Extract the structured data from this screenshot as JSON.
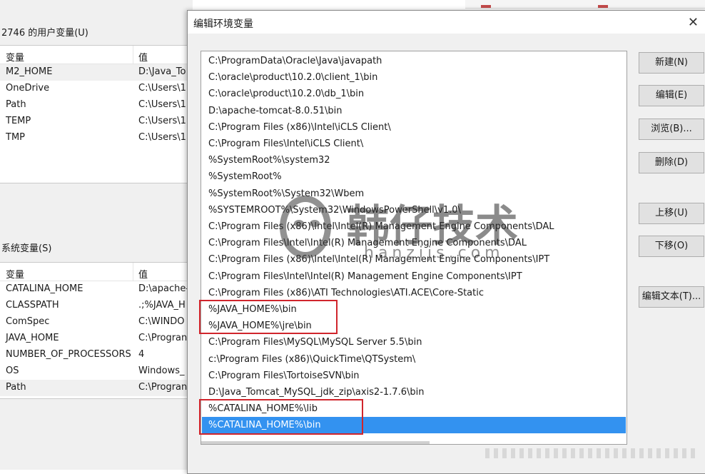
{
  "background_window": {
    "user_vars_label": "2746 的用户变量(U)",
    "user_vars": {
      "col_var": "变量",
      "col_val": "值",
      "rows": [
        {
          "name": "M2_HOME",
          "value": "D:\\Java_To"
        },
        {
          "name": "OneDrive",
          "value": "C:\\Users\\1"
        },
        {
          "name": "Path",
          "value": "C:\\Users\\1"
        },
        {
          "name": "TEMP",
          "value": "C:\\Users\\1"
        },
        {
          "name": "TMP",
          "value": "C:\\Users\\1"
        }
      ]
    },
    "system_vars_label": "系统变量(S)",
    "system_vars": {
      "col_var": "变量",
      "col_val": "值",
      "rows": [
        {
          "name": "CATALINA_HOME",
          "value": "D:\\apache-"
        },
        {
          "name": "CLASSPATH",
          "value": ".;%JAVA_H"
        },
        {
          "name": "ComSpec",
          "value": "C:\\WINDO"
        },
        {
          "name": "JAVA_HOME",
          "value": "C:\\Progran"
        },
        {
          "name": "NUMBER_OF_PROCESSORS",
          "value": "4"
        },
        {
          "name": "OS",
          "value": "Windows_"
        },
        {
          "name": "Path",
          "value": "C:\\Progran"
        }
      ]
    }
  },
  "dialog": {
    "title": "编辑环境变量",
    "close_icon": "close-icon",
    "paths": [
      "C:\\ProgramData\\Oracle\\Java\\javapath",
      "C:\\oracle\\product\\10.2.0\\client_1\\bin",
      "C:\\oracle\\product\\10.2.0\\db_1\\bin",
      "D:\\apache-tomcat-8.0.51\\bin",
      "C:\\Program Files (x86)\\Intel\\iCLS Client\\",
      "C:\\Program Files\\Intel\\iCLS Client\\",
      "%SystemRoot%\\system32",
      "%SystemRoot%",
      "%SystemRoot%\\System32\\Wbem",
      "%SYSTEMROOT%\\System32\\WindowsPowerShell\\v1.0\\",
      "C:\\Program Files (x86)\\Intel\\Intel(R) Management Engine Components\\DAL",
      "C:\\Program Files\\Intel\\Intel(R) Management Engine Components\\DAL",
      "C:\\Program Files (x86)\\Intel\\Intel(R) Management Engine Components\\IPT",
      "C:\\Program Files\\Intel\\Intel(R) Management Engine Components\\IPT",
      "C:\\Program Files (x86)\\ATI Technologies\\ATI.ACE\\Core-Static",
      "%JAVA_HOME%\\bin",
      "%JAVA_HOME%\\jre\\bin",
      "C:\\Program Files\\MySQL\\MySQL Server 5.5\\bin",
      "c:\\Program Files (x86)\\QuickTime\\QTSystem\\",
      "C:\\Program Files\\TortoiseSVN\\bin",
      "D:\\Java_Tomcat_MySQL_jdk_zip\\axis2-1.7.6\\bin",
      "%CATALINA_HOME%\\lib",
      "%CATALINA_HOME%\\bin"
    ],
    "selected_index": 22,
    "buttons": {
      "new": "新建(N)",
      "edit": "编辑(E)",
      "browse": "浏览(B)...",
      "delete": "删除(D)",
      "move_up": "上移(U)",
      "move_down": "下移(O)",
      "edit_text": "编辑文本(T)..."
    },
    "highlight_color": "#d0252c",
    "selection_color": "#3392f0"
  },
  "watermark": {
    "text": "韩仔技术",
    "sub": "hanzijs.com"
  }
}
